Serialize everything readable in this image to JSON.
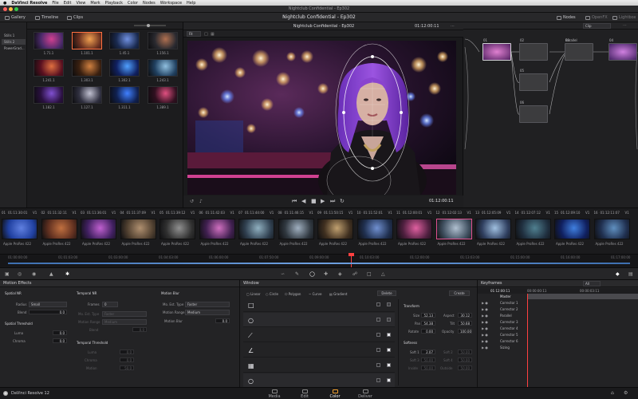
{
  "menubar": {
    "apple": "",
    "app_name": "DaVinci Resolve",
    "items": [
      "File",
      "Edit",
      "View",
      "Mark",
      "Playback",
      "Color",
      "Nodes",
      "Workspace",
      "Help"
    ]
  },
  "window": {
    "title": "Nightclub Confidential - Ep302"
  },
  "toolbar": {
    "gallery": "Gallery",
    "timeline": "Timeline",
    "clips": "Clips",
    "project_name": "Nightclub Confidential - Ep302",
    "nodes": "Nodes",
    "openfx": "OpenFX",
    "lightbox": "Lightbox"
  },
  "gallery_sidebar": [
    "Stills 1",
    "Stills 2",
    "PowerGrad..."
  ],
  "stills": [
    "1.71.1",
    "1.101.1",
    "1.45.1",
    "1.156.1",
    "1.241.1",
    "1.303.1",
    "1.302.1",
    "1.243.1",
    "1.182.1",
    "1.127.1",
    "1.311.1",
    "1.389.1"
  ],
  "viewer": {
    "title": "Nightclub Confidential - Ep302",
    "timecode_top": "01:12:00:11",
    "fit": "Fit",
    "clip_dropdown": "Clip",
    "timecode": "01:12:00:11"
  },
  "nodes": {
    "labels": [
      "01",
      "02",
      "03",
      "04",
      "05",
      "06"
    ],
    "parallel": "Parallel"
  },
  "clips": [
    {
      "num": "01",
      "tc": "01:11:30:01",
      "v": "V1",
      "codec": "Apple ProRes 422"
    },
    {
      "num": "02",
      "tc": "01:11:32:11",
      "v": "V1",
      "codec": "Apple ProRes 422"
    },
    {
      "num": "03",
      "tc": "01:11:36:01",
      "v": "V1",
      "codec": "Apple ProRes 422"
    },
    {
      "num": "04",
      "tc": "01:11:37:09",
      "v": "V1",
      "codec": "Apple ProRes 422"
    },
    {
      "num": "05",
      "tc": "01:11:39:12",
      "v": "V1",
      "codec": "Apple ProRes 422"
    },
    {
      "num": "06",
      "tc": "01:11:42:03",
      "v": "V1",
      "codec": "Apple ProRes 422"
    },
    {
      "num": "07",
      "tc": "01:11:44:00",
      "v": "V1",
      "codec": "Apple ProRes 422"
    },
    {
      "num": "08",
      "tc": "01:11:46:15",
      "v": "V1",
      "codec": "Apple ProRes 422"
    },
    {
      "num": "09",
      "tc": "01:11:50:15",
      "v": "V1",
      "codec": "Apple ProRes 422"
    },
    {
      "num": "10",
      "tc": "01:11:52:01",
      "v": "V1",
      "codec": "Apple ProRes 422"
    },
    {
      "num": "11",
      "tc": "01:12:00:01",
      "v": "V1",
      "codec": "Apple ProRes 422"
    },
    {
      "num": "12",
      "tc": "01:12:02:13",
      "v": "V1",
      "codec": "Apple ProRes 422"
    },
    {
      "num": "13",
      "tc": "01:12:05:09",
      "v": "V1",
      "codec": "Apple ProRes 422"
    },
    {
      "num": "14",
      "tc": "01:12:07:12",
      "v": "V1",
      "codec": "Apple ProRes 422"
    },
    {
      "num": "15",
      "tc": "01:12:09:10",
      "v": "V1",
      "codec": "Apple ProRes 422"
    },
    {
      "num": "16",
      "tc": "01:12:11:07",
      "v": "V1",
      "codec": "Apple ProRes 422"
    }
  ],
  "timeline_ruler": [
    "01:00:00:00",
    "01:01:03:00",
    "01:03:00:00",
    "01:04:03:00",
    "01:06:00:00",
    "01:07:50:00",
    "01:09:00:00",
    "01:10:03:00",
    "01:12:00:00",
    "01:13:03:00",
    "01:15:00:00",
    "01:16:00:00",
    "01:17:00:00"
  ],
  "motion_effects": {
    "title": "Motion Effects",
    "spatial_nr": "Spatial NR",
    "radius_label": "Radius",
    "radius_value": "Small",
    "blend_label": "Blend",
    "blend_value": "0.0",
    "spatial_threshold": "Spatial Threshold",
    "luma_label": "Luma",
    "luma_value": "0.0",
    "chroma_label": "Chroma",
    "chroma_value": "0.0",
    "temporal_nr": "Temporal NR",
    "frames_label": "Frames",
    "frames_value": "0",
    "mo_est_type_label": "Mo. Est. Type",
    "mo_est_type_value": "Faster",
    "motion_range_label": "Motion Range",
    "motion_range_value": "Medium",
    "blend2_label": "Blend",
    "blend2_value": "0.0",
    "temporal_threshold": "Temporal Threshold",
    "t_luma_label": "Luma",
    "t_luma_value": "0.0",
    "t_chroma_label": "Chroma",
    "t_chroma_value": "0.0",
    "motion_label": "Motion",
    "motion_value": "50.0",
    "motion_blur": "Motion Blur",
    "mb_est_type_label": "Mo. Est. Type",
    "mb_est_type_value": "Faster",
    "mb_range_label": "Motion Range",
    "mb_range_value": "Medium",
    "mb_blur_label": "Motion Blur",
    "mb_blur_value": "0.0"
  },
  "window_panel": {
    "title": "Window",
    "linear": "Linear",
    "circle": "Circle",
    "polygon": "Polygon",
    "curve": "Curve",
    "gradient": "Gradient",
    "delete": "Delete",
    "create": "Create",
    "transform": "Transform",
    "size_label": "Size",
    "size_value": "52.13",
    "aspect_label": "Aspect",
    "aspect_value": "30.12",
    "pan_label": "Pan",
    "pan_value": "54.38",
    "tilt_label": "Tilt",
    "tilt_value": "50.68",
    "rotate_label": "Rotate",
    "rotate_value": "0.00",
    "opacity_label": "Opacity",
    "opacity_value": "100.00",
    "softness": "Softness",
    "soft1_label": "Soft 1",
    "soft1_value": "2.07",
    "soft2_label": "Soft 2",
    "soft3_label": "Soft 3",
    "soft4_label": "Soft 4",
    "inside_label": "Inside",
    "outside_label": "Outside",
    "placeholder": "50.00"
  },
  "keyframes": {
    "title": "Keyframes",
    "filter": "All",
    "tc1": "01:12:00:11",
    "tc2": "00:00:00:11",
    "tc3": "00:00:03:11",
    "master": "Master",
    "items": [
      "Corrector 1",
      "Corrector 2",
      "Parallel",
      "Corrector 3",
      "Corrector 4",
      "Corrector 5",
      "Corrector 6",
      "Sizing"
    ]
  },
  "bottom": {
    "app_label": "DaVinci Resolve 12",
    "pages": [
      "Media",
      "Edit",
      "Color",
      "Deliver"
    ],
    "active_page": "Color"
  }
}
